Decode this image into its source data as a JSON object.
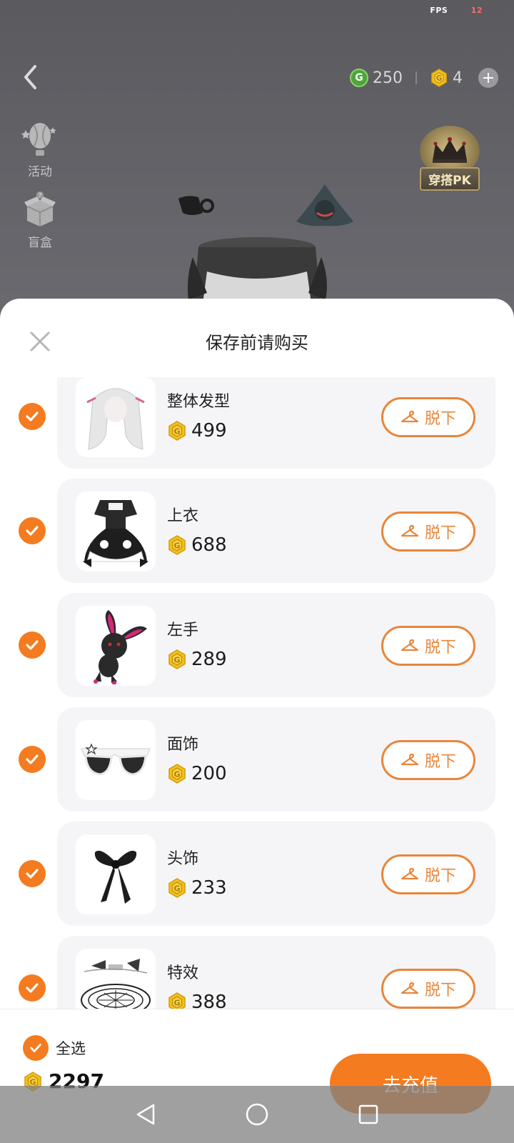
{
  "status": {
    "fps_label": "FPS",
    "fps_value": "12"
  },
  "top_bar": {
    "green_currency": "250",
    "gold_currency": "4"
  },
  "side_menu": [
    {
      "label": "活动",
      "icon": "hot-air-balloon-icon"
    },
    {
      "label": "盲盒",
      "icon": "mystery-box-icon"
    }
  ],
  "pk_badge": {
    "label": "穿搭PK"
  },
  "sheet": {
    "title": "保存前请购买",
    "items": [
      {
        "name": "整体发型",
        "price": "499",
        "button": "脱下",
        "checked": true,
        "icon": "hairstyle-thumb"
      },
      {
        "name": "上衣",
        "price": "688",
        "button": "脱下",
        "checked": true,
        "icon": "maid-dress-thumb"
      },
      {
        "name": "左手",
        "price": "289",
        "button": "脱下",
        "checked": true,
        "icon": "bunny-plush-thumb"
      },
      {
        "name": "面饰",
        "price": "200",
        "button": "脱下",
        "checked": true,
        "icon": "sunglasses-thumb"
      },
      {
        "name": "头饰",
        "price": "233",
        "button": "脱下",
        "checked": true,
        "icon": "bow-thumb"
      },
      {
        "name": "特效",
        "price": "388",
        "button": "脱下",
        "checked": true,
        "icon": "magic-circle-thumb"
      }
    ]
  },
  "footer": {
    "select_all_label": "全选",
    "total": "2297",
    "recharge_label": "去充值"
  },
  "colors": {
    "accent": "#f47b20",
    "outline": "#e8863a"
  }
}
